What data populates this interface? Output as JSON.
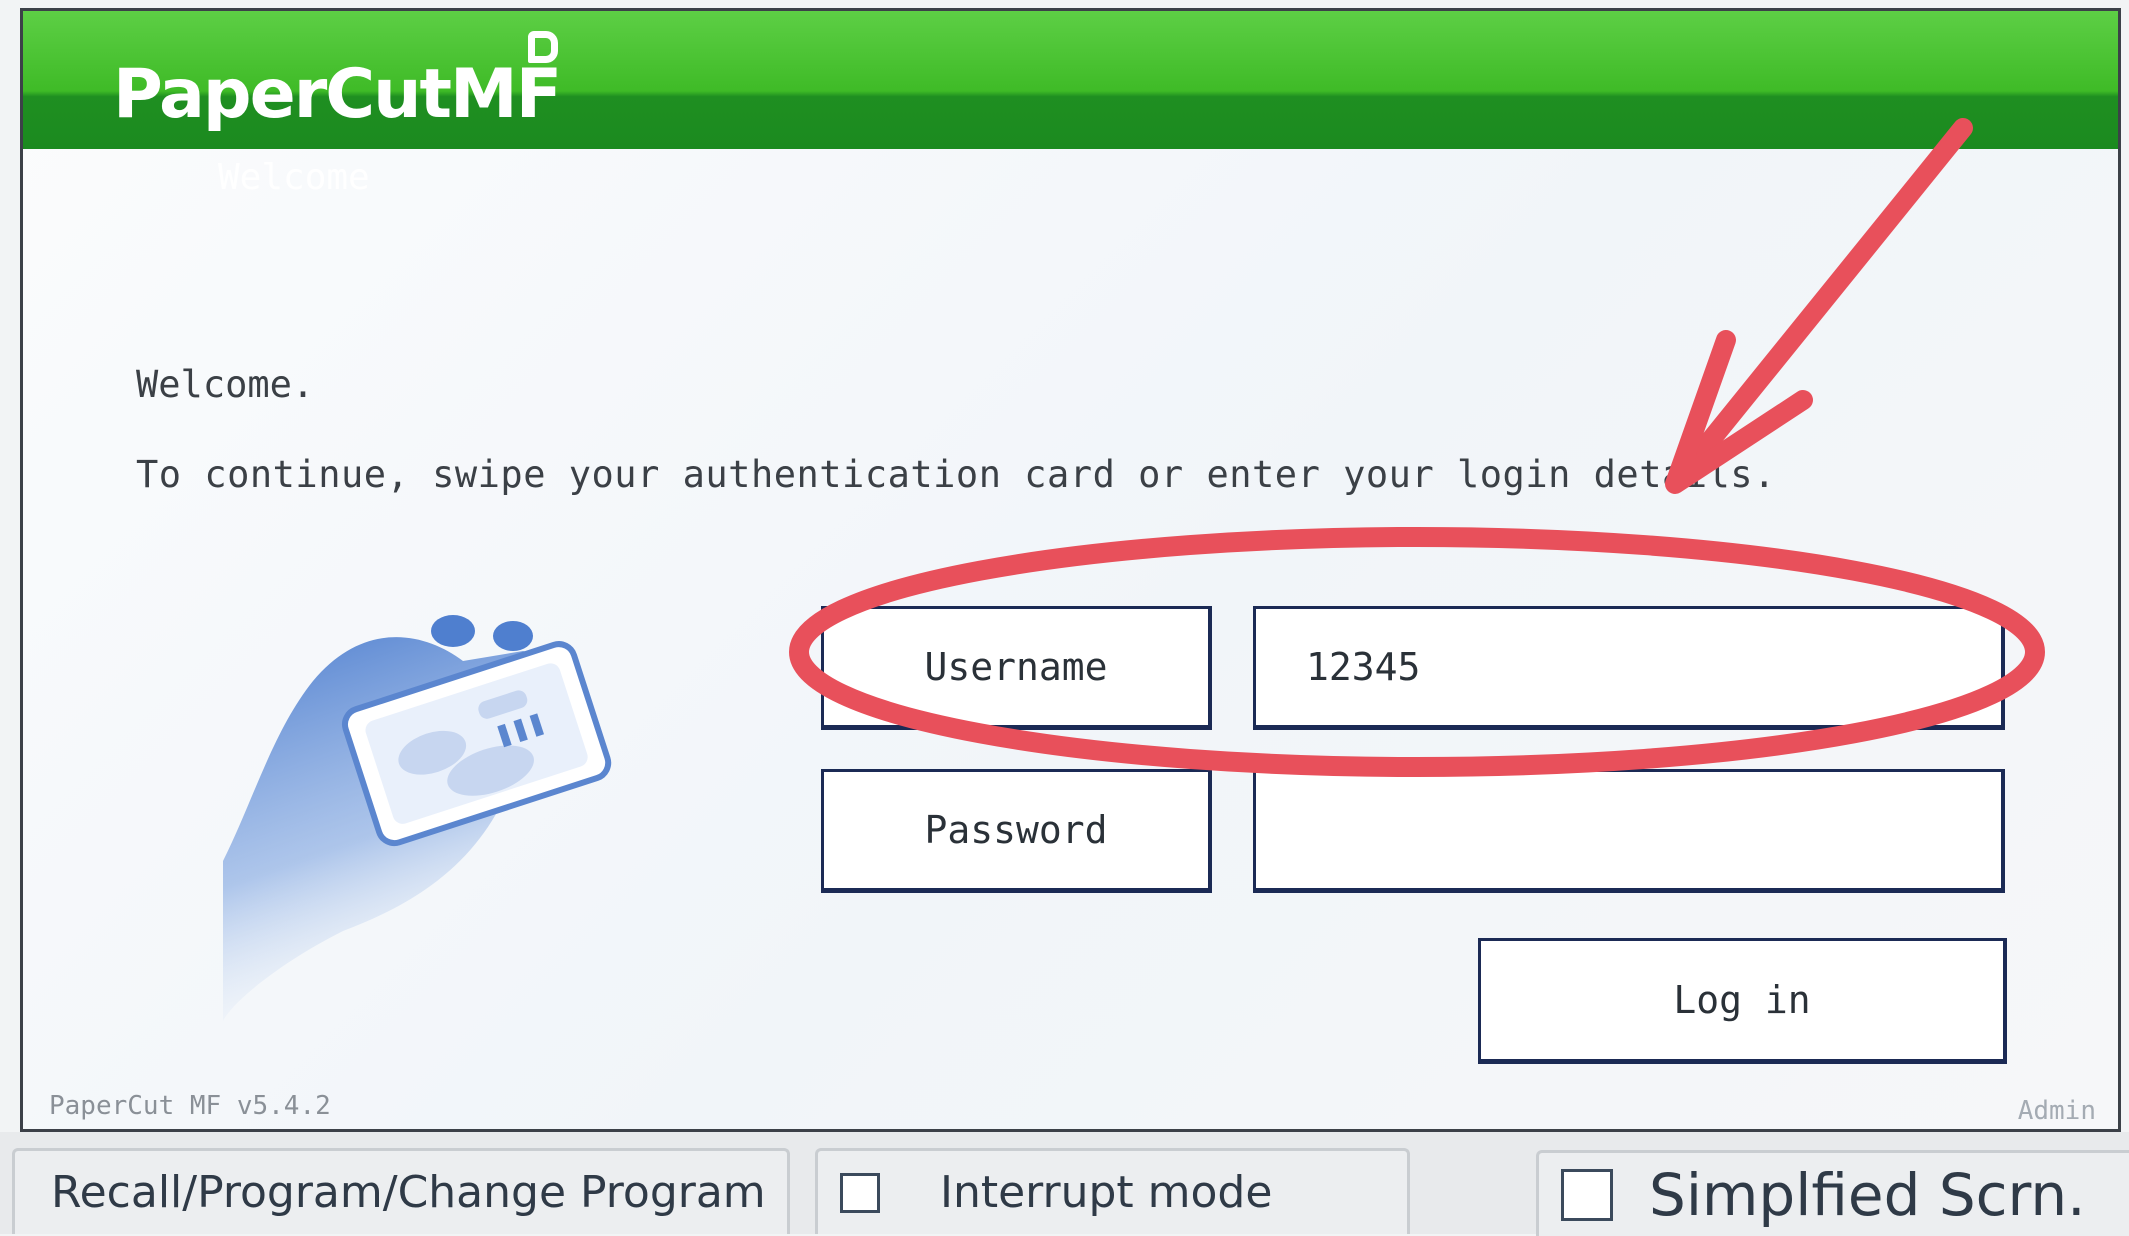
{
  "header": {
    "logo": "PaperCutMF",
    "subtitle": "Welcome"
  },
  "main": {
    "welcome": "Welcome.",
    "instruction": "To continue, swipe your authentication card or enter your login details."
  },
  "form": {
    "username_label": "Username",
    "username_value": "12345",
    "password_label": "Password",
    "password_value": "",
    "login_label": "Log in"
  },
  "footer": {
    "version": "PaperCut MF v5.4.2",
    "admin": "Admin"
  },
  "bottom_bar": {
    "recall": "Recall/Program/Change Program",
    "interrupt": "Interrupt mode",
    "simplified": "Simplfied Scrn."
  },
  "colors": {
    "header_green": "#3fbb27",
    "annotation_red": "#e8505b",
    "field_border": "#1b2a55"
  },
  "icons": [
    "hand-card-illustration",
    "papercut-p-icon",
    "checkbox-icon",
    "annotation-arrow",
    "annotation-ellipse"
  ]
}
